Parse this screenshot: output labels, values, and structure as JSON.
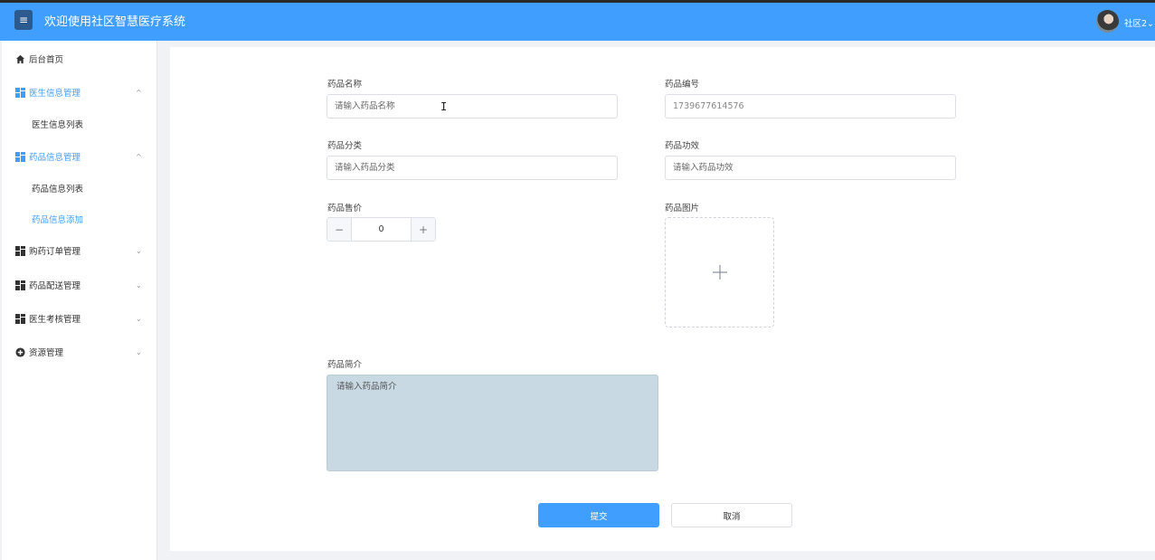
{
  "header": {
    "title": "欢迎使用社区智慧医疗系统",
    "menu_icon": "≡",
    "user": "社区2"
  },
  "sidebar": {
    "items": [
      {
        "label": "后台首页",
        "icon": "home-icon"
      },
      {
        "label": "医生信息管理",
        "icon": "grid-icon",
        "expanded": true
      },
      {
        "label": "医生信息列表",
        "sub": true
      },
      {
        "label": "药品信息管理",
        "icon": "grid-icon",
        "expanded": true
      },
      {
        "label": "药品信息列表",
        "sub": true
      },
      {
        "label": "药品信息添加",
        "sub": true,
        "active": true
      },
      {
        "label": "购药订单管理",
        "icon": "grid-icon",
        "expanded": false
      },
      {
        "label": "药品配送管理",
        "icon": "grid-icon",
        "expanded": false
      },
      {
        "label": "医生考核管理",
        "icon": "grid-icon",
        "expanded": false
      },
      {
        "label": "资源管理",
        "icon": "plus-circle-icon",
        "expanded": false
      }
    ]
  },
  "form": {
    "name_label": "药品名称",
    "name_placeholder": "请输入药品名称",
    "code_label": "药品编号",
    "code_value": "1739677614576",
    "category_label": "药品分类",
    "category_placeholder": "请输入药品分类",
    "effect_label": "药品功效",
    "effect_placeholder": "请输入药品功效",
    "price_label": "药品售价",
    "price_value": "0",
    "image_label": "药品图片",
    "intro_label": "药品简介",
    "intro_placeholder": "请输入药品简介",
    "submit_label": "提交",
    "cancel_label": "取消"
  },
  "colors": {
    "primary": "#409eff",
    "textarea_bg": "#c8d9e3"
  }
}
